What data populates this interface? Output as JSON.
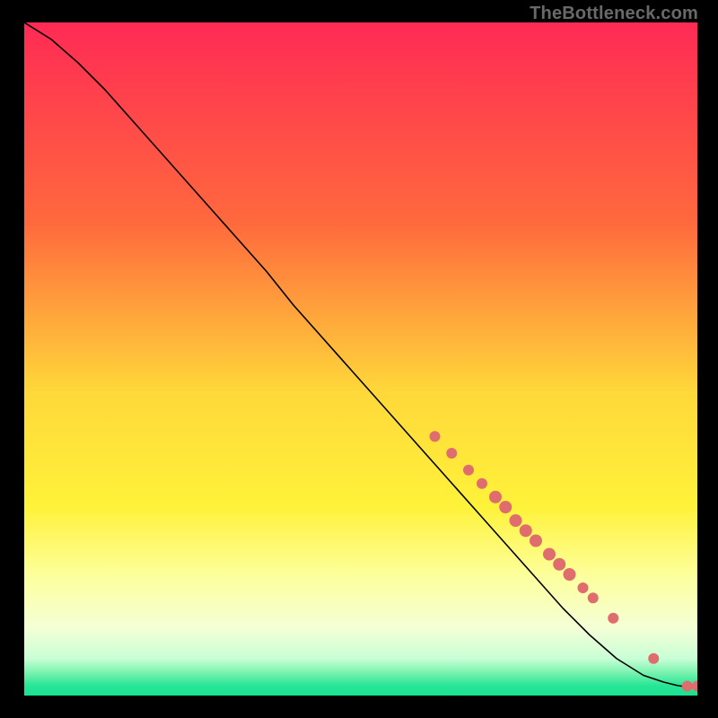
{
  "watermark": "TheBottleneck.com",
  "chart_data": {
    "type": "line",
    "title": "",
    "xlabel": "",
    "ylabel": "",
    "xlim": [
      0,
      100
    ],
    "ylim": [
      0,
      100
    ],
    "grid": false,
    "legend": "none",
    "gradient_stops": [
      {
        "offset": 0,
        "color": "#ff2a55"
      },
      {
        "offset": 0.3,
        "color": "#ff6a3d"
      },
      {
        "offset": 0.55,
        "color": "#ffd83a"
      },
      {
        "offset": 0.72,
        "color": "#fff23a"
      },
      {
        "offset": 0.82,
        "color": "#fdff9a"
      },
      {
        "offset": 0.9,
        "color": "#f4ffd6"
      },
      {
        "offset": 0.945,
        "color": "#c9ffd6"
      },
      {
        "offset": 0.965,
        "color": "#7ef3b0"
      },
      {
        "offset": 0.985,
        "color": "#28e597"
      },
      {
        "offset": 1.0,
        "color": "#19e18f"
      }
    ],
    "series": [
      {
        "name": "curve",
        "color": "#000000",
        "x": [
          0,
          4,
          8,
          12,
          16,
          20,
          24,
          28,
          32,
          36,
          40,
          44,
          48,
          52,
          56,
          60,
          64,
          68,
          72,
          76,
          80,
          84,
          88,
          92,
          95,
          97,
          99,
          100
        ],
        "y": [
          100,
          97.5,
          94,
          90,
          85.5,
          81,
          76.5,
          72,
          67.5,
          63,
          58,
          53.5,
          49,
          44.5,
          40,
          35.5,
          31,
          26.5,
          22,
          17.5,
          13,
          9,
          5.5,
          3,
          2,
          1.5,
          1.2,
          1.2
        ]
      }
    ],
    "markers": {
      "name": "points",
      "color": "#e06d6d",
      "radius_small": 6,
      "radius_large": 7,
      "x": [
        61,
        63.5,
        66,
        68,
        70,
        71.5,
        73,
        74.5,
        76,
        78,
        79.5,
        81,
        83,
        84.5,
        87.5,
        93.5,
        98.5,
        100
      ],
      "y": [
        38.5,
        36,
        33.5,
        31.5,
        29.5,
        28,
        26,
        24.5,
        23,
        21,
        19.5,
        18,
        16,
        14.5,
        11.5,
        5.5,
        1.4,
        1.4
      ],
      "large_idx": [
        4,
        5,
        6,
        7,
        8,
        9,
        10,
        11
      ]
    }
  }
}
